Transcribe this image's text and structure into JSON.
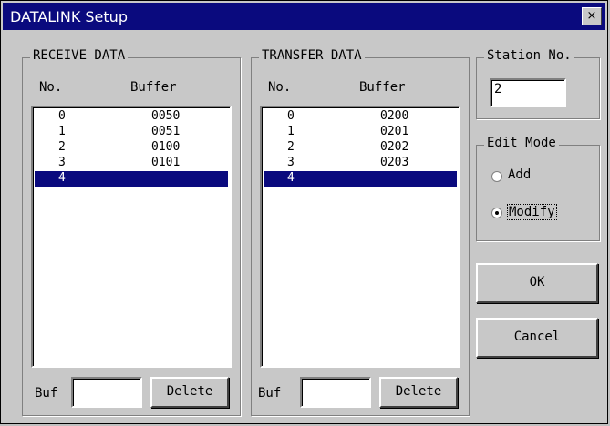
{
  "window": {
    "title": "DATALINK Setup",
    "close_glyph": "×"
  },
  "receive": {
    "title": "RECEIVE DATA",
    "col_no": "No.",
    "col_buffer": "Buffer",
    "rows": [
      {
        "no": "0",
        "buf": "0050"
      },
      {
        "no": "1",
        "buf": "0051"
      },
      {
        "no": "2",
        "buf": "0100"
      },
      {
        "no": "3",
        "buf": "0101"
      },
      {
        "no": "4",
        "buf": ""
      }
    ],
    "selected_index": 4,
    "buf_label": "Buf",
    "buf_value": "",
    "delete_label": "Delete"
  },
  "transfer": {
    "title": "TRANSFER DATA",
    "col_no": "No.",
    "col_buffer": "Buffer",
    "rows": [
      {
        "no": "0",
        "buf": "0200"
      },
      {
        "no": "1",
        "buf": "0201"
      },
      {
        "no": "2",
        "buf": "0202"
      },
      {
        "no": "3",
        "buf": "0203"
      },
      {
        "no": "4",
        "buf": ""
      }
    ],
    "selected_index": 4,
    "buf_label": "Buf",
    "buf_value": "",
    "delete_label": "Delete"
  },
  "station": {
    "title": "Station No.",
    "value": "2"
  },
  "edit_mode": {
    "title": "Edit Mode",
    "add_label": "Add",
    "modify_label": "Modify",
    "selected": "Modify"
  },
  "buttons": {
    "ok_label": "OK",
    "cancel_label": "Cancel"
  },
  "colors": {
    "titlebar": "#0a0a7e",
    "selection": "#0a0a7e",
    "face": "#c8c8c8"
  }
}
